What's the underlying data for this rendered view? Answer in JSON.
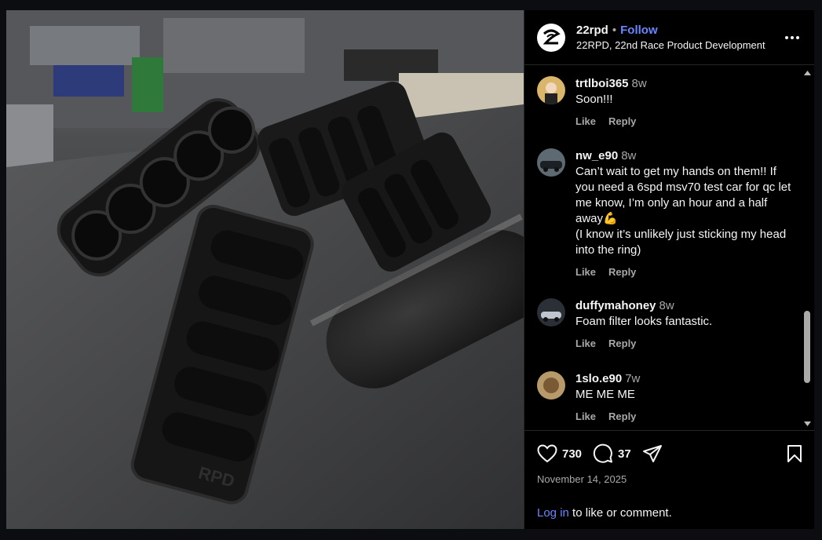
{
  "post": {
    "username": "22rpd",
    "follow_label": "Follow",
    "separator": "•",
    "subtitle": "22RPD, 22nd Race Product Development",
    "photo_alt": "Black intake manifolds on a workbench",
    "photo_logo_text": "RPD"
  },
  "comments": [
    {
      "user": "trtlboi365",
      "time": "8w",
      "text": "Soon!!!",
      "like": "Like",
      "reply": "Reply"
    },
    {
      "user": "nw_e90",
      "time": "8w",
      "text": "Can’t wait to get my hands on them!! If you need a 6spd msv70 test car for qc let me know, I’m only an hour and a half away💪\n(I know it’s unlikely just sticking my head into the ring)",
      "like": "Like",
      "reply": "Reply"
    },
    {
      "user": "duffymahoney",
      "time": "8w",
      "text": "Foam filter looks fantastic.",
      "like": "Like",
      "reply": "Reply"
    },
    {
      "user": "1slo.e90",
      "time": "7w",
      "text": "ME ME ME",
      "like": "Like",
      "reply": "Reply"
    }
  ],
  "footer": {
    "likes": "730",
    "comments_count": "37",
    "date": "November 14, 2025",
    "login_link": "Log in",
    "login_rest": " to like or comment."
  },
  "colors": {
    "accent": "#6a86ff",
    "muted": "#a8a8a8",
    "background": "#000000"
  },
  "icons": [
    "heart-icon",
    "comment-icon",
    "share-icon",
    "bookmark-icon",
    "more-icon",
    "scroll-up-icon",
    "scroll-down-icon"
  ]
}
